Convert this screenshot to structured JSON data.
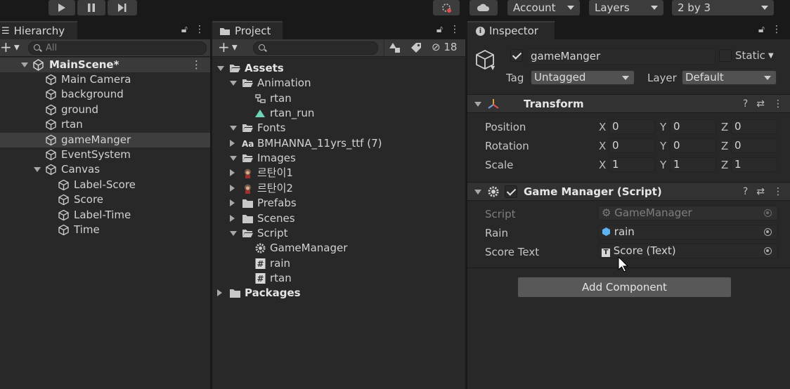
{
  "toolbar": {
    "account_label": "Account",
    "layers_label": "Layers",
    "layout_label": "2 by 3"
  },
  "hierarchy": {
    "tab_label": "Hierarchy",
    "search_placeholder": "All",
    "scene_name": "MainScene*",
    "items": [
      {
        "label": "Main Camera"
      },
      {
        "label": "background"
      },
      {
        "label": "ground"
      },
      {
        "label": "rtan"
      },
      {
        "label": "gameManger"
      },
      {
        "label": "EventSystem"
      },
      {
        "label": "Canvas"
      },
      {
        "label": "Label-Score"
      },
      {
        "label": "Score"
      },
      {
        "label": "Label-Time"
      },
      {
        "label": "Time"
      }
    ]
  },
  "project": {
    "tab_label": "Project",
    "hidden_count": "18",
    "items": [
      {
        "label": "Assets",
        "icon": "folder-open-icon"
      },
      {
        "label": "Animation",
        "icon": "folder-open-icon"
      },
      {
        "label": "rtan",
        "icon": "animator-controller-icon"
      },
      {
        "label": "rtan_run",
        "icon": "animation-clip-icon"
      },
      {
        "label": "Fonts",
        "icon": "folder-open-icon"
      },
      {
        "label": "BMHANNA_11yrs_ttf (7)",
        "icon": "font-icon",
        "icon_text": "Aa"
      },
      {
        "label": "Images",
        "icon": "folder-open-icon"
      },
      {
        "label": "르탄이1",
        "icon": "sprite-icon"
      },
      {
        "label": "르탄이2",
        "icon": "sprite-icon"
      },
      {
        "label": "Prefabs",
        "icon": "folder-icon"
      },
      {
        "label": "Scenes",
        "icon": "folder-icon"
      },
      {
        "label": "Script",
        "icon": "folder-open-icon"
      },
      {
        "label": "GameManager",
        "icon": "gear-icon"
      },
      {
        "label": "rain",
        "icon": "csharp-script-icon",
        "icon_text": "#"
      },
      {
        "label": "rtan",
        "icon": "csharp-script-icon",
        "icon_text": "#"
      },
      {
        "label": "Packages",
        "icon": "folder-icon"
      }
    ]
  },
  "inspector": {
    "tab_label": "Inspector",
    "object_name": "gameManger",
    "static_label": "Static",
    "tag_label": "Tag",
    "tag_value": "Untagged",
    "layer_label": "Layer",
    "layer_value": "Default",
    "transform": {
      "title": "Transform",
      "position_label": "Position",
      "rotation_label": "Rotation",
      "scale_label": "Scale",
      "axis_x": "X",
      "axis_y": "Y",
      "axis_z": "Z",
      "position": [
        "0",
        "0",
        "0"
      ],
      "rotation": [
        "0",
        "0",
        "0"
      ],
      "scale": [
        "1",
        "1",
        "1"
      ]
    },
    "game_manager": {
      "title": "Game Manager (Script)",
      "script_label": "Script",
      "script_value": "GameManager",
      "rain_label": "Rain",
      "rain_value": "rain",
      "score_text_label": "Score Text",
      "score_text_value": "Score (Text)",
      "score_text_icon": "T"
    },
    "add_component_label": "Add Component"
  },
  "colors": {
    "panel_bg": "#282828",
    "header_bg": "#323232",
    "field_bg": "#2a2a2a",
    "selection_bg": "#3e3e3e",
    "toolbar_bg": "#191919"
  }
}
